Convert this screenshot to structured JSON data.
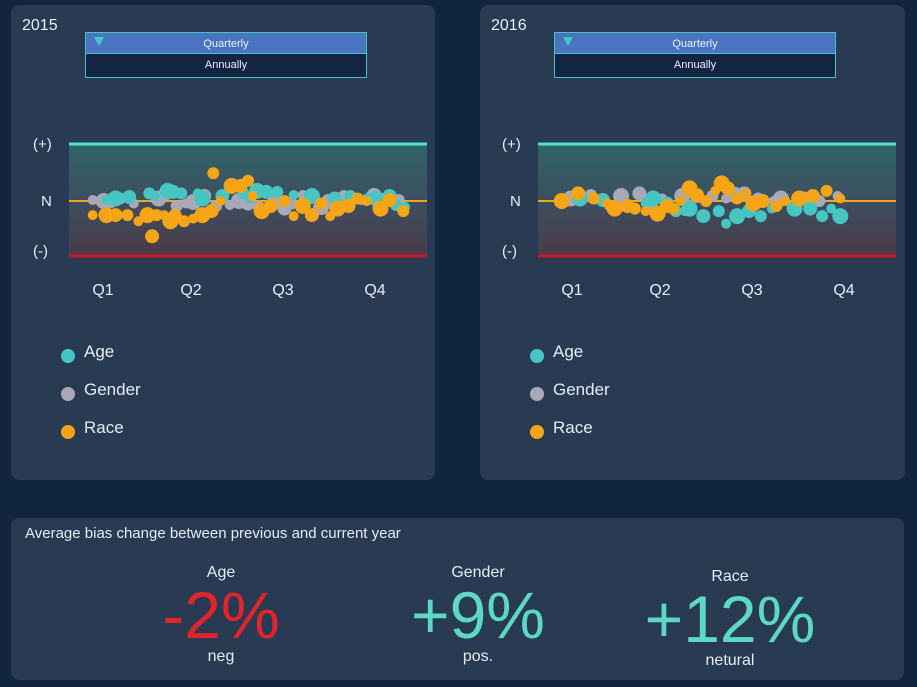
{
  "colors": {
    "background": "#122540",
    "panel": "#293a53",
    "age": "#46c6c3",
    "gender": "#a9a8b8",
    "race": "#f6a516",
    "top_border": "#56e3c5",
    "bottom_border": "#d2152a",
    "neutral_line": "#f6a516",
    "negative": "#e3242b",
    "positive": "#5ed8c6"
  },
  "period_options": [
    "Quarterly",
    "Annually"
  ],
  "panels": [
    {
      "year": "2015",
      "period_selected": "Quarterly",
      "period_other": "Annually",
      "y_labels": [
        "(+)",
        "N",
        "(-)"
      ],
      "x_labels": [
        "Q1",
        "Q2",
        "Q3",
        "Q4"
      ],
      "legend": [
        "Age",
        "Gender",
        "Race"
      ]
    },
    {
      "year": "2016",
      "period_selected": "Quarterly",
      "period_other": "Annually",
      "y_labels": [
        "(+)",
        "N",
        "(-)"
      ],
      "x_labels": [
        "Q1",
        "Q2",
        "Q3",
        "Q4"
      ],
      "legend": [
        "Age",
        "Gender",
        "Race"
      ]
    }
  ],
  "summary": {
    "title": "Average bias change between previous and current year",
    "metrics": [
      {
        "name": "Age",
        "value": "-2%",
        "sub": "neg",
        "color": "#e3242b"
      },
      {
        "name": "Gender",
        "value": "+9%",
        "sub": "pos.",
        "color": "#5ed8c6"
      },
      {
        "name": "Race",
        "value": "+12%",
        "sub": "netural",
        "color": "#5ed8c6"
      }
    ]
  },
  "chart_data": [
    {
      "type": "scatter",
      "title": "2015",
      "categories": [
        "Q1",
        "Q2",
        "Q3",
        "Q4"
      ],
      "y_axis_labels": [
        "(+)",
        "N",
        "(-)"
      ],
      "ylim": [
        -1,
        1
      ],
      "series": [
        {
          "name": "Age",
          "points": [
            [
              0.05,
              0.02
            ],
            [
              0.15,
              0.05
            ],
            [
              0.3,
              0.08
            ],
            [
              0.52,
              0.15
            ],
            [
              0.58,
              0.1
            ],
            [
              0.72,
              0.2
            ],
            [
              0.78,
              0.18
            ],
            [
              0.87,
              0.15
            ],
            [
              1.05,
              0.15
            ],
            [
              1.1,
              0.05
            ],
            [
              1.32,
              0.1
            ],
            [
              1.55,
              0.15
            ],
            [
              1.62,
              0.05
            ],
            [
              1.7,
              0.2
            ],
            [
              1.8,
              0.18
            ],
            [
              1.92,
              0.18
            ],
            [
              2.1,
              0.12
            ],
            [
              2.3,
              0.1
            ],
            [
              2.55,
              0.05
            ],
            [
              2.72,
              0.1
            ],
            [
              2.9,
              0.05
            ],
            [
              3.0,
              0.05
            ],
            [
              3.15,
              0.1
            ],
            [
              3.22,
              -0.08
            ],
            [
              3.32,
              -0.12
            ]
          ]
        },
        {
          "name": "Gender",
          "points": [
            [
              -0.1,
              0.02
            ],
            [
              0.02,
              0.0
            ],
            [
              0.1,
              0.0
            ],
            [
              0.2,
              0.05
            ],
            [
              0.35,
              -0.05
            ],
            [
              0.62,
              0.05
            ],
            [
              0.7,
              0.15
            ],
            [
              0.82,
              -0.1
            ],
            [
              0.92,
              -0.05
            ],
            [
              1.0,
              -0.02
            ],
            [
              1.12,
              0.1
            ],
            [
              1.25,
              -0.1
            ],
            [
              1.4,
              -0.08
            ],
            [
              1.5,
              0.0
            ],
            [
              1.6,
              -0.05
            ],
            [
              1.72,
              -0.12
            ],
            [
              1.82,
              -0.15
            ],
            [
              1.9,
              0.0
            ],
            [
              2.0,
              -0.15
            ],
            [
              2.08,
              -0.05
            ],
            [
              2.2,
              0.12
            ],
            [
              2.4,
              -0.12
            ],
            [
              2.48,
              0.0
            ],
            [
              2.65,
              0.1
            ],
            [
              2.85,
              0.02
            ],
            [
              2.98,
              0.1
            ],
            [
              3.08,
              0.02
            ],
            [
              3.25,
              0.02
            ]
          ]
        },
        {
          "name": "Race",
          "points": [
            [
              -0.1,
              -0.28
            ],
            [
              0.05,
              -0.28
            ],
            [
              0.15,
              -0.28
            ],
            [
              0.28,
              -0.28
            ],
            [
              0.4,
              -0.4
            ],
            [
              0.5,
              -0.28
            ],
            [
              0.55,
              -0.7
            ],
            [
              0.6,
              -0.28
            ],
            [
              0.68,
              -0.28
            ],
            [
              0.75,
              -0.4
            ],
            [
              0.8,
              -0.3
            ],
            [
              0.9,
              -0.4
            ],
            [
              1.0,
              -0.35
            ],
            [
              1.1,
              -0.28
            ],
            [
              1.2,
              -0.2
            ],
            [
              1.22,
              0.55
            ],
            [
              1.3,
              0.0
            ],
            [
              1.42,
              0.3
            ],
            [
              1.52,
              0.3
            ],
            [
              1.6,
              0.4
            ],
            [
              1.65,
              0.1
            ],
            [
              1.75,
              -0.2
            ],
            [
              1.85,
              -0.1
            ],
            [
              2.0,
              0.0
            ],
            [
              2.1,
              -0.3
            ],
            [
              2.2,
              -0.1
            ],
            [
              2.3,
              -0.28
            ],
            [
              2.4,
              -0.05
            ],
            [
              2.5,
              -0.3
            ],
            [
              2.58,
              -0.15
            ],
            [
              2.7,
              -0.1
            ],
            [
              2.8,
              0.05
            ],
            [
              2.9,
              0.0
            ],
            [
              3.05,
              -0.15
            ],
            [
              3.15,
              0.02
            ],
            [
              3.3,
              -0.2
            ]
          ]
        }
      ]
    },
    {
      "type": "scatter",
      "title": "2016",
      "categories": [
        "Q1",
        "Q2",
        "Q3",
        "Q4"
      ],
      "y_axis_labels": [
        "(+)",
        "N",
        "(-)"
      ],
      "ylim": [
        -1,
        1
      ],
      "series": [
        {
          "name": "Age",
          "points": [
            [
              0.1,
              0.05
            ],
            [
              0.35,
              0.02
            ],
            [
              0.6,
              -0.1
            ],
            [
              0.82,
              -0.05
            ],
            [
              0.9,
              0.05
            ],
            [
              1.05,
              -0.05
            ],
            [
              1.15,
              -0.2
            ],
            [
              1.25,
              -0.2
            ],
            [
              1.3,
              -0.15
            ],
            [
              1.45,
              -0.3
            ],
            [
              1.62,
              -0.2
            ],
            [
              1.7,
              -0.45
            ],
            [
              1.82,
              -0.3
            ],
            [
              1.95,
              -0.2
            ],
            [
              2.08,
              -0.3
            ],
            [
              2.2,
              -0.15
            ],
            [
              2.45,
              -0.15
            ],
            [
              2.62,
              -0.15
            ],
            [
              2.75,
              -0.3
            ],
            [
              2.85,
              -0.15
            ],
            [
              2.95,
              -0.3
            ]
          ]
        },
        {
          "name": "Gender",
          "points": [
            [
              0.0,
              0.05
            ],
            [
              0.1,
              0.1
            ],
            [
              0.22,
              0.12
            ],
            [
              0.42,
              -0.1
            ],
            [
              0.55,
              0.1
            ],
            [
              0.75,
              0.15
            ],
            [
              0.88,
              -0.1
            ],
            [
              1.0,
              0.05
            ],
            [
              1.22,
              0.1
            ],
            [
              1.38,
              0.1
            ],
            [
              1.55,
              0.1
            ],
            [
              1.7,
              0.05
            ],
            [
              1.8,
              0.12
            ],
            [
              1.9,
              0.15
            ],
            [
              2.05,
              0.05
            ],
            [
              2.22,
              0.0
            ],
            [
              2.3,
              0.05
            ],
            [
              2.55,
              0.05
            ],
            [
              2.72,
              0.0
            ],
            [
              2.92,
              0.1
            ]
          ]
        },
        {
          "name": "Race",
          "points": [
            [
              -0.1,
              0.0
            ],
            [
              0.08,
              0.15
            ],
            [
              0.25,
              0.05
            ],
            [
              0.4,
              -0.05
            ],
            [
              0.48,
              -0.15
            ],
            [
              0.62,
              -0.1
            ],
            [
              0.7,
              -0.15
            ],
            [
              0.82,
              -0.2
            ],
            [
              0.95,
              -0.25
            ],
            [
              1.05,
              -0.1
            ],
            [
              1.12,
              -0.15
            ],
            [
              1.2,
              0.0
            ],
            [
              1.3,
              0.25
            ],
            [
              1.38,
              0.12
            ],
            [
              1.48,
              0.0
            ],
            [
              1.58,
              0.2
            ],
            [
              1.65,
              0.35
            ],
            [
              1.72,
              0.25
            ],
            [
              1.82,
              0.05
            ],
            [
              1.92,
              0.15
            ],
            [
              2.0,
              -0.05
            ],
            [
              2.1,
              0.0
            ],
            [
              2.25,
              -0.1
            ],
            [
              2.35,
              0.0
            ],
            [
              2.5,
              0.05
            ],
            [
              2.65,
              0.1
            ],
            [
              2.8,
              0.2
            ],
            [
              2.95,
              0.05
            ]
          ]
        }
      ]
    }
  ]
}
